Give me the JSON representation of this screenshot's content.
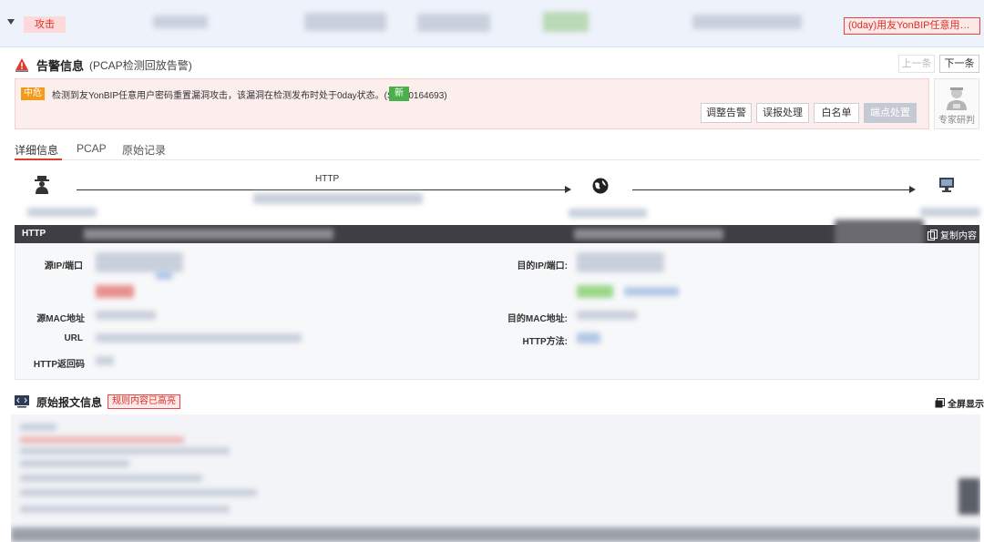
{
  "top_row": {
    "attack_tag": "攻击",
    "vuln_title": "(0day)用友YonBIP任意用户密码重..."
  },
  "alert": {
    "title": "告警信息",
    "subtitle": "(PCAP检测回放告警)",
    "prev_label": "上一条",
    "next_label": "下一条",
    "level": "中危",
    "description": "检测到友YonBIP任意用户密码重置漏洞攻击，该漏洞在检测发布时处于0day状态。(S3100164693)",
    "new_badge": "新",
    "actions": {
      "adjust": "调整告警",
      "false_positive": "误报处理",
      "whitelist": "白名单",
      "endpoint": "端点处置"
    },
    "expert_label": "专家研判"
  },
  "tabs": [
    "详细信息",
    "PCAP",
    "原始记录"
  ],
  "flow": {
    "protocol": "HTTP"
  },
  "http": {
    "section_label": "HTTP",
    "copy_label": "复制内容",
    "fields": {
      "src_ip_port": "源IP/端口",
      "dst_ip_port": "目的IP/端口:",
      "src_mac": "源MAC地址",
      "dst_mac": "目的MAC地址:",
      "url": "URL",
      "http_method": "HTTP方法:",
      "http_status": "HTTP返回码"
    }
  },
  "raw": {
    "title": "原始报文信息",
    "highlight_tag": "规则内容已高亮",
    "fullscreen_label": "全屏显示"
  },
  "colors": {
    "danger": "#e03b2e",
    "medium_level": "#f29a1a",
    "new_badge": "#49b04b",
    "header_bar": "#3e3e44"
  }
}
